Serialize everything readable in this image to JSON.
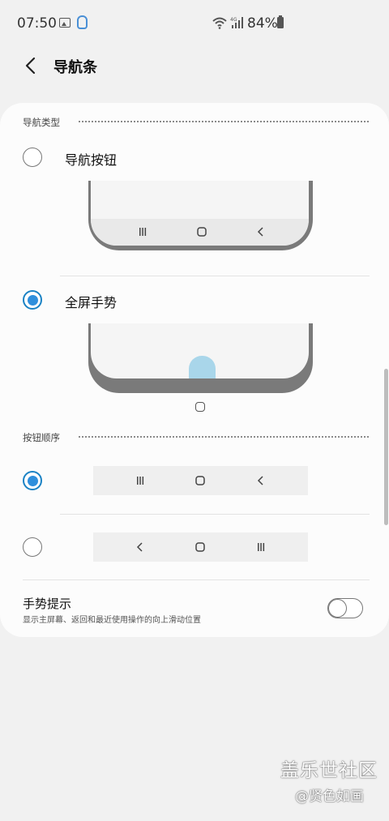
{
  "status_bar": {
    "time": "07:50",
    "battery": "84%",
    "icons": [
      "gallery-icon",
      "samsung-account-icon",
      "wifi-icon",
      "signal-4g-icon",
      "battery-icon"
    ]
  },
  "app_bar": {
    "title": "导航条"
  },
  "nav_type": {
    "header": "导航类型",
    "options": [
      {
        "label": "导航按钮",
        "selected": false
      },
      {
        "label": "全屏手势",
        "selected": true
      }
    ]
  },
  "button_order": {
    "header": "按钮顺序",
    "options": [
      {
        "keys": [
          "recents-icon",
          "home-icon",
          "back-icon"
        ],
        "selected": true
      },
      {
        "keys": [
          "back-icon",
          "home-icon",
          "recents-icon"
        ],
        "selected": false
      }
    ]
  },
  "gesture_hint": {
    "title": "手势提示",
    "subtitle": "显示主屏幕、返回和最近使用操作的向上滑动位置",
    "enabled": false
  },
  "watermark": {
    "main": "盖乐世社区",
    "sub": "@贤色如画"
  },
  "colors": {
    "accent": "#2f8fdc",
    "gesture_handle": "#a9d6ea",
    "card_bg": "#fcfcfc",
    "page_bg": "#f1f1f1"
  }
}
